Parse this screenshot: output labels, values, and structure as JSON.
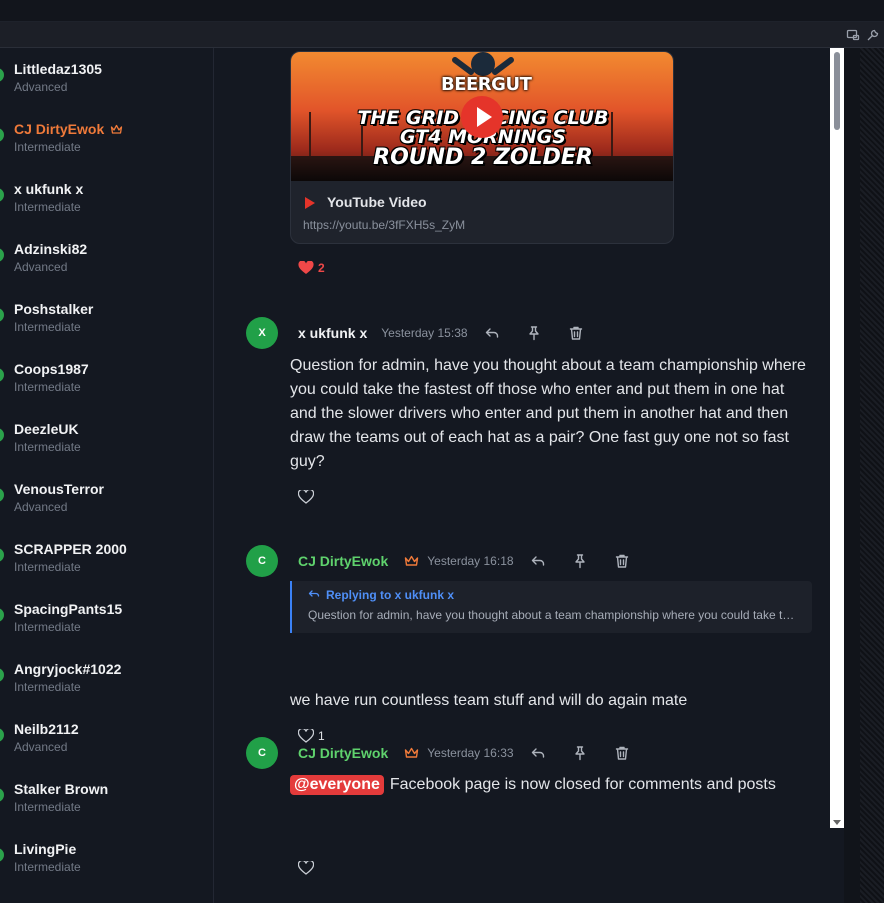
{
  "sidebar": {
    "members": [
      {
        "name": "Littledaz1305",
        "role": "Advanced"
      },
      {
        "name": "CJ DirtyEwok",
        "role": "Intermediate"
      },
      {
        "name": "x ukfunk x",
        "role": "Intermediate"
      },
      {
        "name": "Adzinski82",
        "role": "Advanced"
      },
      {
        "name": "Poshstalker",
        "role": "Intermediate"
      },
      {
        "name": "Coops1987",
        "role": "Intermediate"
      },
      {
        "name": "DeezleUK",
        "role": "Intermediate"
      },
      {
        "name": "VenousTerror",
        "role": "Advanced"
      },
      {
        "name": "SCRAPPER 2000",
        "role": "Intermediate"
      },
      {
        "name": "SpacingPants15",
        "role": "Intermediate"
      },
      {
        "name": "Angryjock#1022",
        "role": "Intermediate"
      },
      {
        "name": "Neilb2112",
        "role": "Advanced"
      },
      {
        "name": "Stalker Brown",
        "role": "Intermediate"
      },
      {
        "name": "LivingPie",
        "role": "Intermediate"
      }
    ]
  },
  "embed": {
    "logo_text": "BEERGUT",
    "thumb_line1": "THE GRID RACING CLUB",
    "thumb_line2": "GT4 MORNINGS",
    "thumb_line3": "ROUND 2 ZOLDER",
    "title": "YouTube Video",
    "url": "https://youtu.be/3fFXH5s_ZyM",
    "reaction_count": "2"
  },
  "messages": [
    {
      "initial": "X",
      "author": "x ukfunk x",
      "time": "Yesterday 15:38",
      "text": "Question for admin, have you thought about a team championship where you could take the fastest off those who enter and put them in one hat and the slower drivers who enter and put them in another hat and then draw the teams out of each hat as a pair? One fast guy one not so fast guy?",
      "reaction_count": ""
    },
    {
      "initial": "C",
      "author": "CJ DirtyEwok",
      "time": "Yesterday 16:18",
      "reply_label": "Replying to x ukfunk x",
      "reply_text": "Question for admin, have you thought about a team championship where you could take the fastest off those who enter and put them in one hat",
      "text": "we have run countless team stuff and will do again mate",
      "reaction_count": "1"
    },
    {
      "initial": "C",
      "author": "CJ DirtyEwok",
      "time": "Yesterday 16:33",
      "mention": "@everyone",
      "text": "Facebook page is now closed for comments and posts",
      "reaction_count": ""
    }
  ],
  "colors": {
    "background": "#141821",
    "online": "#2ba24b",
    "admin_sidebar": "#f07a3a",
    "admin_chat": "#5fd26d",
    "mention": "#e43b3b",
    "reply_accent": "#3b82f6",
    "heart_liked": "#ef4848"
  },
  "icons": [
    "screen-share-icon",
    "wrench-icon",
    "crown-icon",
    "reply-icon",
    "pin-icon",
    "trash-icon",
    "heart-icon",
    "play-icon"
  ]
}
